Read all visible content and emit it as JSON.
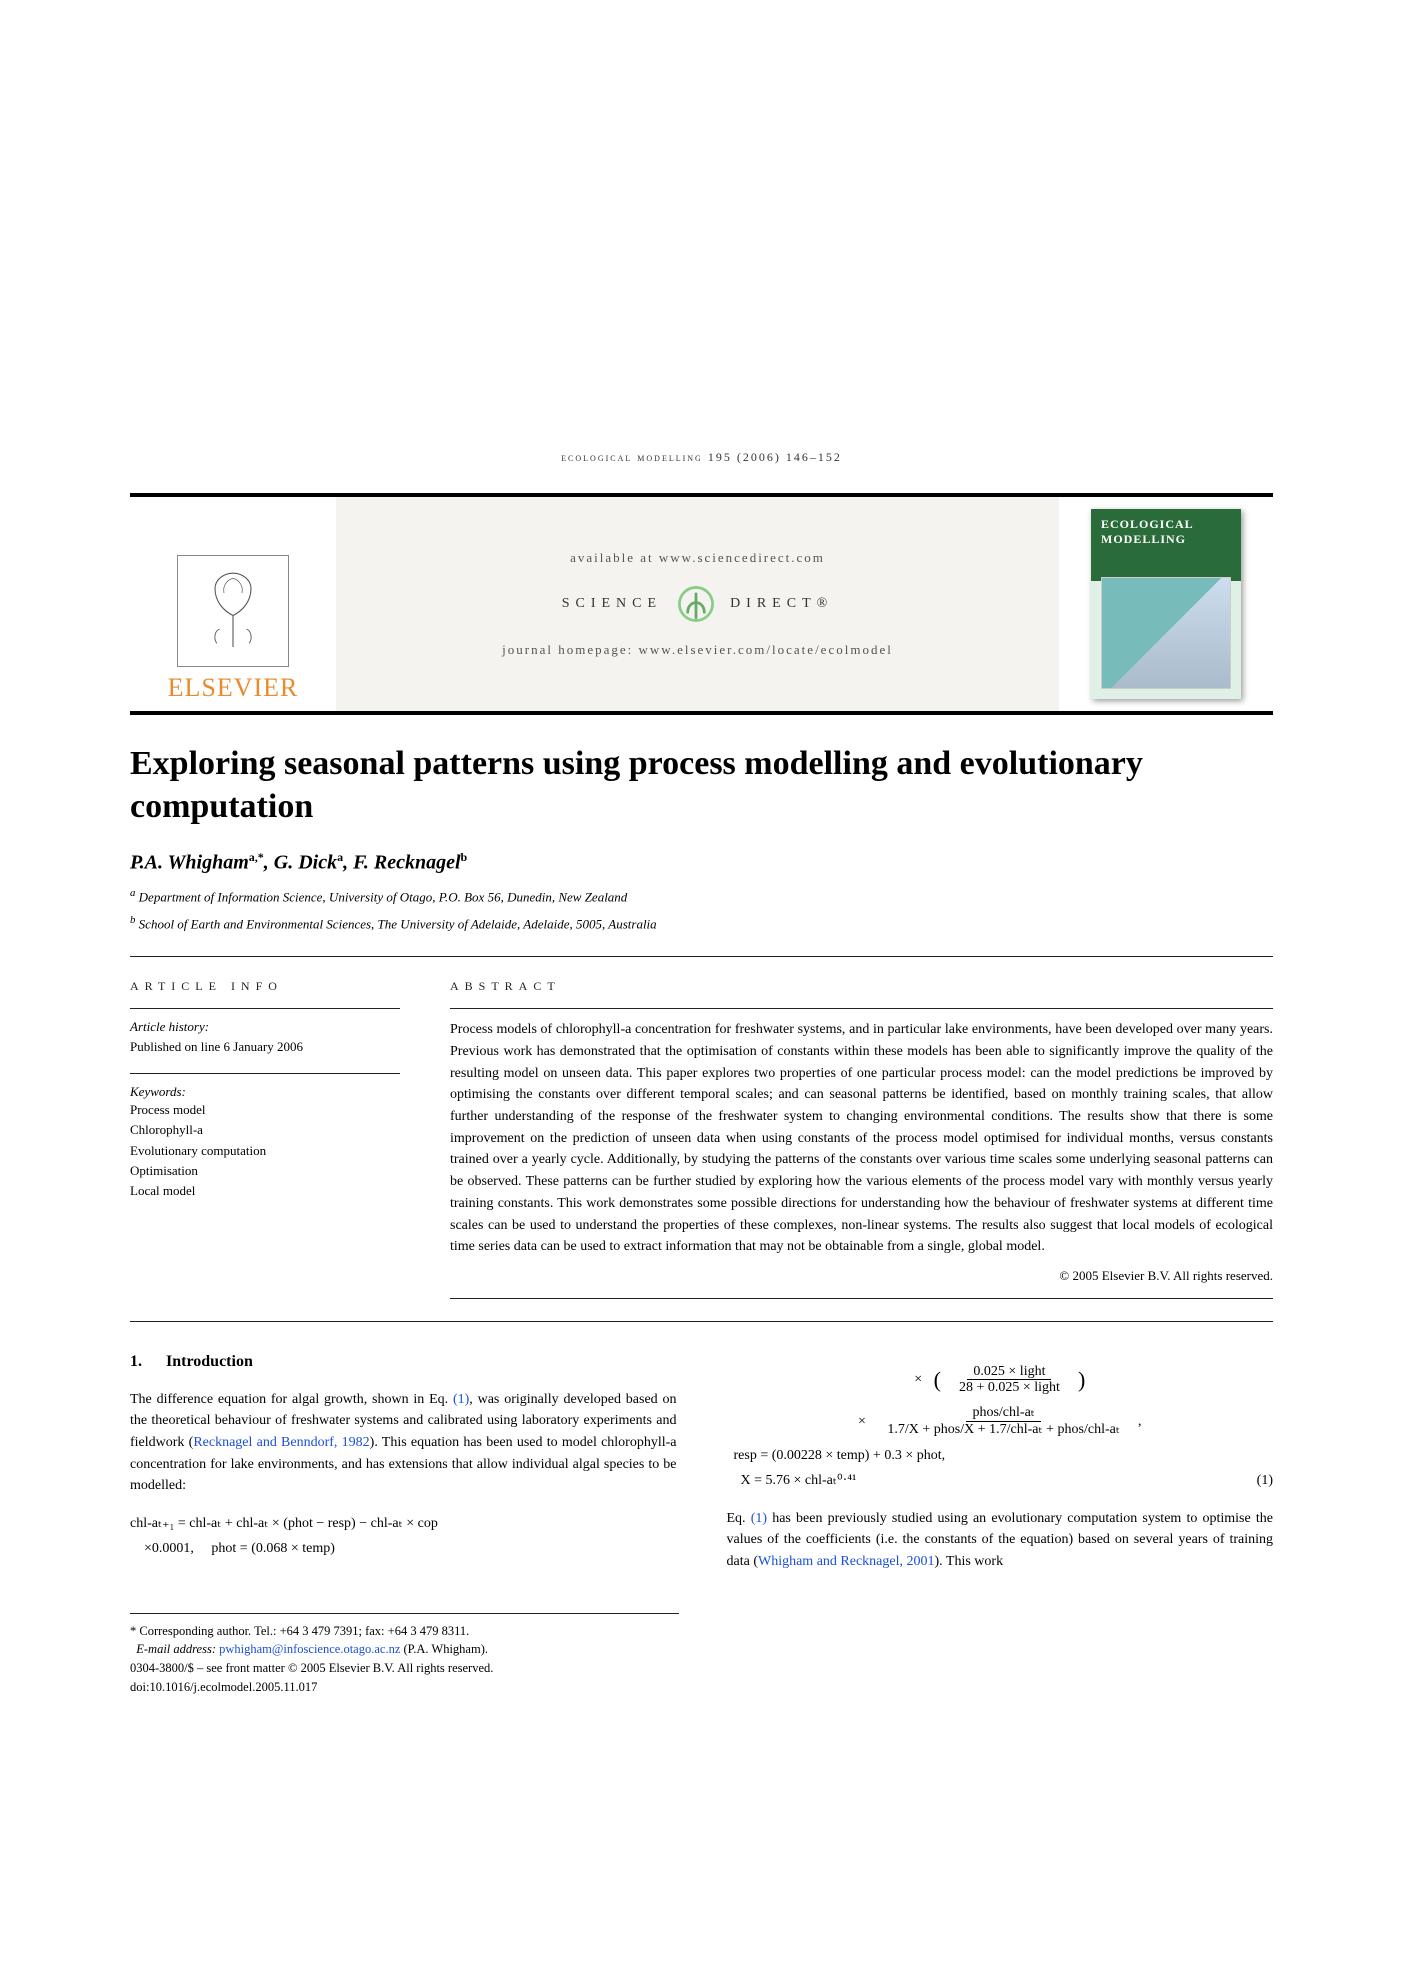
{
  "running_head": "ecological modelling 195 (2006) 146–152",
  "masthead": {
    "available_at": "available at www.sciencedirect.com",
    "sd_left": "SCIENCE",
    "sd_right": "DIRECT®",
    "homepage_label": "journal homepage: www.elsevier.com/locate/ecolmodel",
    "publisher": "ELSEVIER",
    "journal_cover_title": "ECOLOGICAL MODELLING"
  },
  "title": "Exploring seasonal patterns using process modelling and evolutionary computation",
  "authors_html": {
    "a1_name": "P.A. Whigham",
    "a1_sup": "a,*",
    "a2_name": "G. Dick",
    "a2_sup": "a",
    "a3_name": "F. Recknagel",
    "a3_sup": "b"
  },
  "affiliations": {
    "a": "Department of Information Science, University of Otago, P.O. Box 56, Dunedin, New Zealand",
    "b": "School of Earth and Environmental Sciences, The University of Adelaide, Adelaide, 5005, Australia"
  },
  "article_info_head": "ARTICLE INFO",
  "abstract_head": "ABSTRACT",
  "history_label": "Article history:",
  "history_value": "Published on line 6 January 2006",
  "keywords_label": "Keywords:",
  "keywords": [
    "Process model",
    "Chlorophyll-a",
    "Evolutionary computation",
    "Optimisation",
    "Local model"
  ],
  "abstract": "Process models of chlorophyll-a concentration for freshwater systems, and in particular lake environments, have been developed over many years. Previous work has demonstrated that the optimisation of constants within these models has been able to significantly improve the quality of the resulting model on unseen data. This paper explores two properties of one particular process model: can the model predictions be improved by optimising the constants over different temporal scales; and can seasonal patterns be identified, based on monthly training scales, that allow further understanding of the response of the freshwater system to changing environmental conditions. The results show that there is some improvement on the prediction of unseen data when using constants of the process model optimised for individual months, versus constants trained over a yearly cycle. Additionally, by studying the patterns of the constants over various time scales some underlying seasonal patterns can be observed. These patterns can be further studied by exploring how the various elements of the process model vary with monthly versus yearly training constants. This work demonstrates some possible directions for understanding how the behaviour of freshwater systems at different time scales can be used to understand the properties of these complexes, non-linear systems. The results also suggest that local models of ecological time series data can be used to extract information that may not be obtainable from a single, global model.",
  "copyright": "© 2005 Elsevier B.V. All rights reserved.",
  "section1_num": "1.",
  "section1_title": "Introduction",
  "intro_p1_a": "The difference equation for algal growth, shown in Eq. ",
  "intro_p1_eqref1": "(1)",
  "intro_p1_b": ", was originally developed based on the theoretical behaviour of freshwater systems and calibrated using laboratory experiments and fieldwork (",
  "intro_p1_ref1": "Recknagel and Benndorf, 1982",
  "intro_p1_c": "). This equation has been used to model chlorophyll-a concentration for lake environments, and has extensions that allow individual algal species to be modelled:",
  "eq": {
    "l1": "chl-aₜ₊₁ = chl-aₜ + chl-aₜ × (phot − resp) − chl-aₜ × cop",
    "l2a": "×0.0001,",
    "l2b": "phot = (0.068 × temp)",
    "frac1_num": "0.025 × light",
    "frac1_den": "28 + 0.025 × light",
    "frac2_num": "phos/chl-aₜ",
    "frac2_den": "1.7/X + phos/X + 1.7/chl-aₜ + phos/chl-aₜ",
    "l4": "resp = (0.00228 × temp) + 0.3 × phot,",
    "l5": "X = 5.76 × chl-aₜ⁰·⁴¹",
    "eqnum": "(1)"
  },
  "intro_p2_a": "Eq. ",
  "intro_p2_eqref1": "(1)",
  "intro_p2_b": " has been previously studied using an evolutionary computation system to optimise the values of the coefficients (i.e. the constants of the equation) based on several years of training data (",
  "intro_p2_ref1": "Whigham and Recknagel, 2001",
  "intro_p2_c": "). This work",
  "footnotes": {
    "corr": "* Corresponding author. Tel.: +64 3 479 7391; fax: +64 3 479 8311.",
    "email_label": "E-mail address:",
    "email": "pwhigham@infoscience.otago.ac.nz",
    "email_who": "(P.A. Whigham).",
    "front": "0304-3800/$ – see front matter © 2005 Elsevier B.V. All rights reserved.",
    "doi": "doi:10.1016/j.ecolmodel.2005.11.017"
  }
}
